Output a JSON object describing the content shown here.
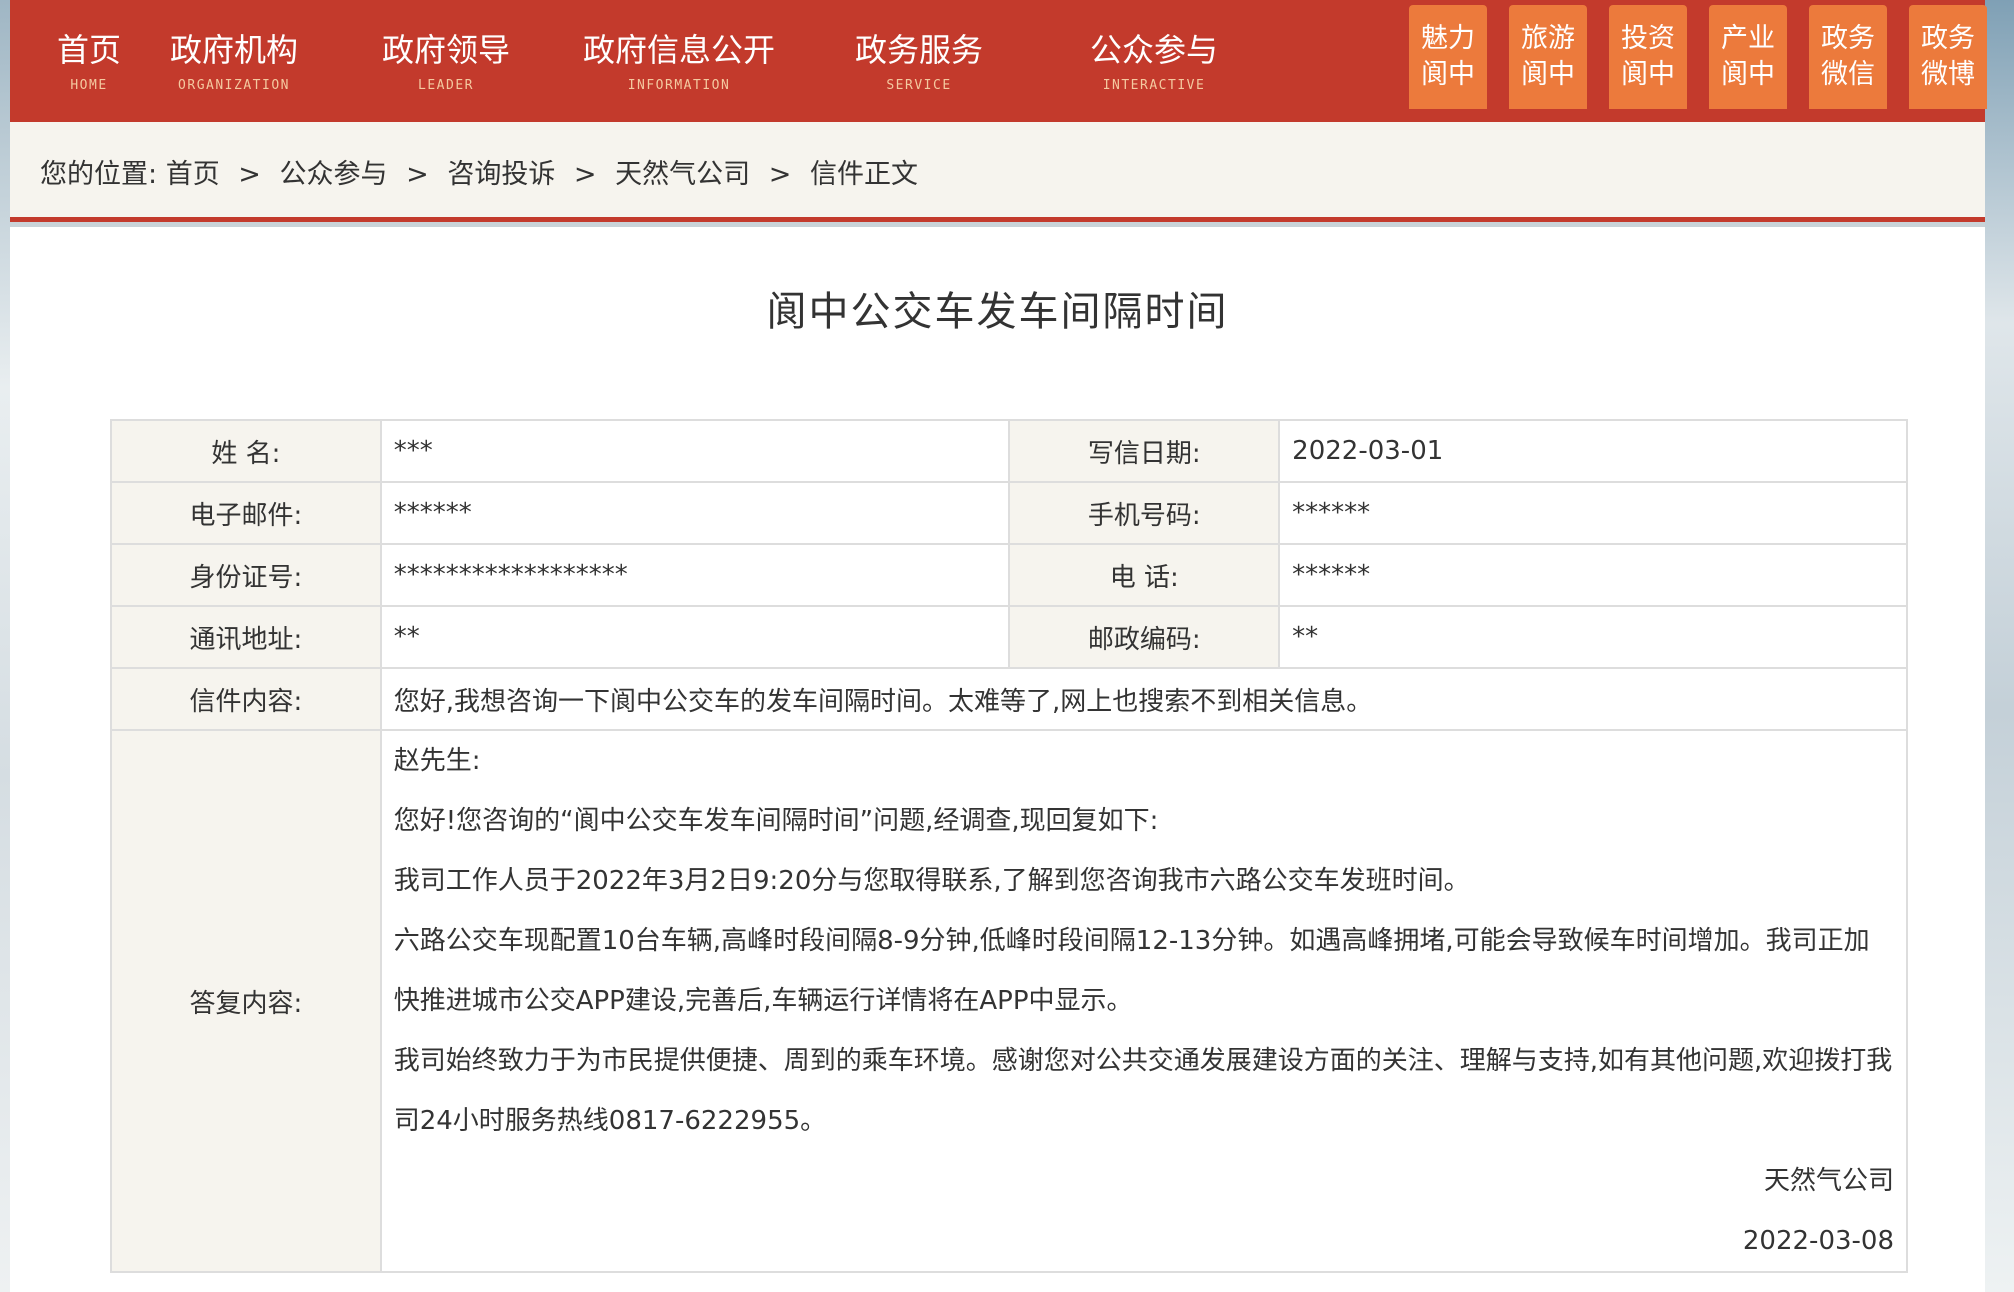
{
  "nav": {
    "items": [
      {
        "cn": "首页",
        "en": "HOME"
      },
      {
        "cn": "政府机构",
        "en": "ORGANIZATION"
      },
      {
        "cn": "政府领导",
        "en": "LEADER"
      },
      {
        "cn": "政府信息公开",
        "en": "INFORMATION"
      },
      {
        "cn": "政务服务",
        "en": "SERVICE"
      },
      {
        "cn": "公众参与",
        "en": "INTERACTIVE"
      }
    ],
    "quick_links": [
      {
        "line1": "魅力",
        "line2": "阆中"
      },
      {
        "line1": "旅游",
        "line2": "阆中"
      },
      {
        "line1": "投资",
        "line2": "阆中"
      },
      {
        "line1": "产业",
        "line2": "阆中"
      },
      {
        "line1": "政务",
        "line2": "微信"
      },
      {
        "line1": "政务",
        "line2": "微博"
      }
    ]
  },
  "breadcrumb": {
    "prefix": "您的位置:",
    "items": [
      "首页",
      "公众参与",
      "咨询投诉",
      "天然气公司",
      "信件正文"
    ],
    "separator": ">"
  },
  "letter": {
    "title": "阆中公交车发车间隔时间",
    "fields": {
      "name_label": "姓 名:",
      "name_value": "***",
      "date_label": "写信日期:",
      "date_value": "2022-03-01",
      "email_label": "电子邮件:",
      "email_value": "******",
      "mobile_label": "手机号码:",
      "mobile_value": "******",
      "id_label": "身份证号:",
      "id_value": "******************",
      "phone_label": "电 话:",
      "phone_value": "******",
      "address_label": "通讯地址:",
      "address_value": "**",
      "postcode_label": "邮政编码:",
      "postcode_value": "**",
      "content_label": "信件内容:",
      "content_value": "您好,我想咨询一下阆中公交车的发车间隔时间。太难等了,网上也搜索不到相关信息。",
      "reply_label": "答复内容:"
    },
    "reply": {
      "greeting": "赵先生:",
      "p1": "您好!您咨询的“阆中公交车发车间隔时间”问题,经调查,现回复如下:",
      "p2": "我司工作人员于2022年3月2日9:20分与您取得联系,了解到您咨询我市六路公交车发班时间。",
      "p3": "六路公交车现配置10台车辆,高峰时段间隔8-9分钟,低峰时段间隔12-13分钟。如遇高峰拥堵,可能会导致候车时间增加。我司正加快推进城市公交APP建设,完善后,车辆运行详情将在APP中显示。",
      "p4": "我司始终致力于为市民提供便捷、周到的乘车环境。感谢您对公共交通发展建设方面的关注、理解与支持,如有其他问题,欢迎拨打我司24小时服务热线0817-6222955。",
      "signature": "天然气公司",
      "date": "2022-03-08"
    }
  },
  "colors": {
    "nav_red": "#c33a2c",
    "quick_orange": "#ec7a3c",
    "label_bg": "#f6f4ee"
  }
}
